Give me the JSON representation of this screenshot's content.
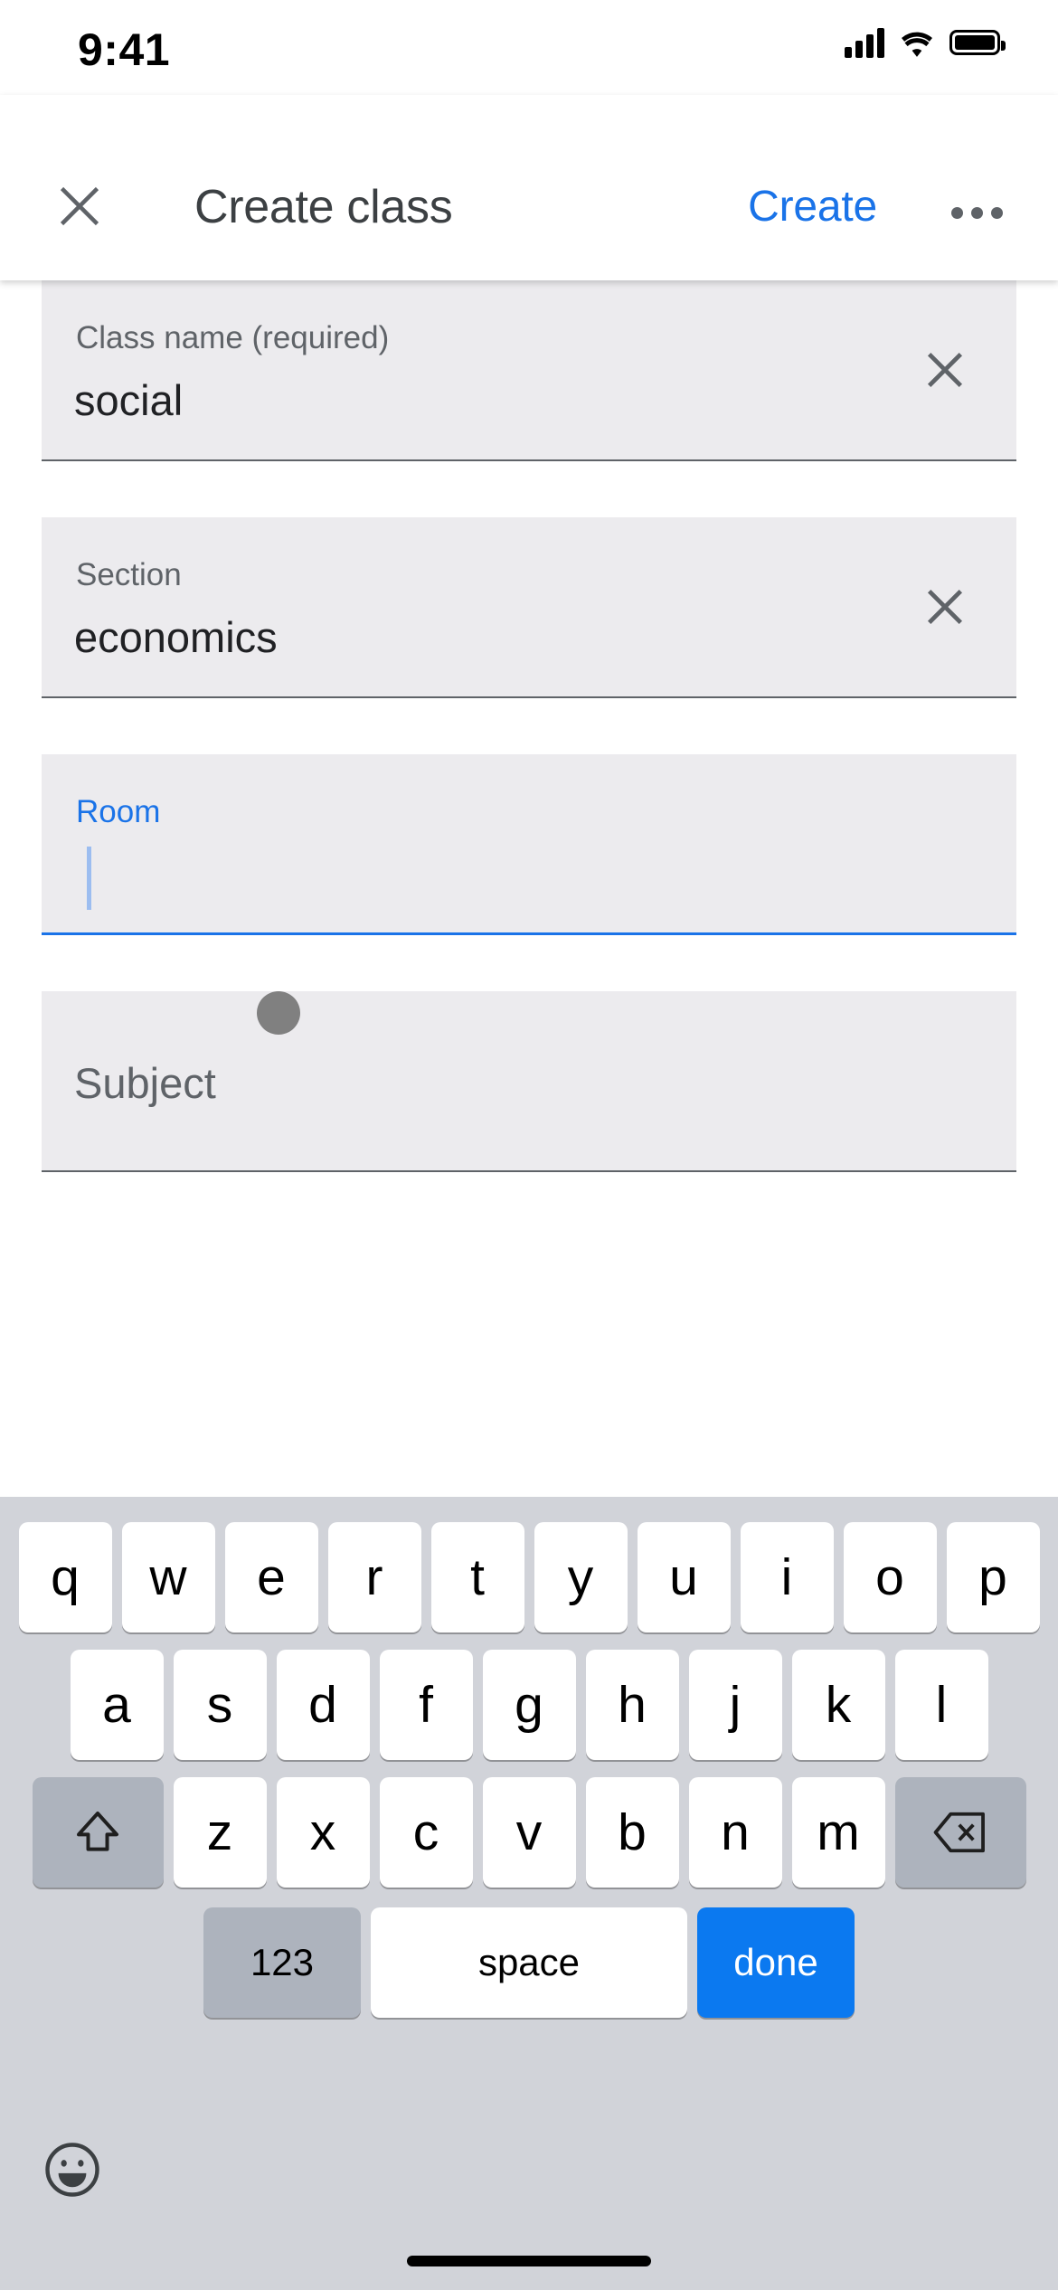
{
  "status_bar": {
    "time": "9:41",
    "signal_icon": "cellular-signal-icon",
    "wifi_icon": "wifi-icon",
    "battery_icon": "battery-icon"
  },
  "app_bar": {
    "close_icon": "close-icon",
    "title": "Create class",
    "create_label": "Create",
    "overflow_icon": "more-options-icon"
  },
  "form": {
    "fields": [
      {
        "name": "class-name",
        "label": "Class name (required)",
        "value": "social",
        "focused": false,
        "has_clear": true,
        "clear_icon": "clear-icon"
      },
      {
        "name": "section",
        "label": "Section",
        "value": "economics",
        "focused": false,
        "has_clear": true,
        "clear_icon": "clear-icon"
      },
      {
        "name": "room",
        "label": "Room",
        "value": "",
        "focused": true,
        "has_clear": false,
        "clear_icon": ""
      },
      {
        "name": "subject",
        "label": "Subject",
        "value": "",
        "focused": false,
        "has_clear": false,
        "clear_icon": ""
      }
    ],
    "touch_indicator": "tap-indicator-dot"
  },
  "keyboard": {
    "row1": [
      "q",
      "w",
      "e",
      "r",
      "t",
      "y",
      "u",
      "i",
      "o",
      "p"
    ],
    "row2": [
      "a",
      "s",
      "d",
      "f",
      "g",
      "h",
      "j",
      "k",
      "l"
    ],
    "row3_letters": [
      "z",
      "x",
      "c",
      "v",
      "b",
      "n",
      "m"
    ],
    "shift_icon": "shift-icon",
    "backspace_icon": "backspace-icon",
    "numbers_label": "123",
    "space_label": "space",
    "done_label": "done",
    "emoji_icon": "emoji-icon",
    "accent_done_color": "#0B79F0"
  },
  "colors": {
    "accent_blue": "#1a73e8",
    "field_bg": "#ECEBEE",
    "keyboard_bg": "#D1D3D9",
    "key_gray": "#ADB3BD"
  }
}
